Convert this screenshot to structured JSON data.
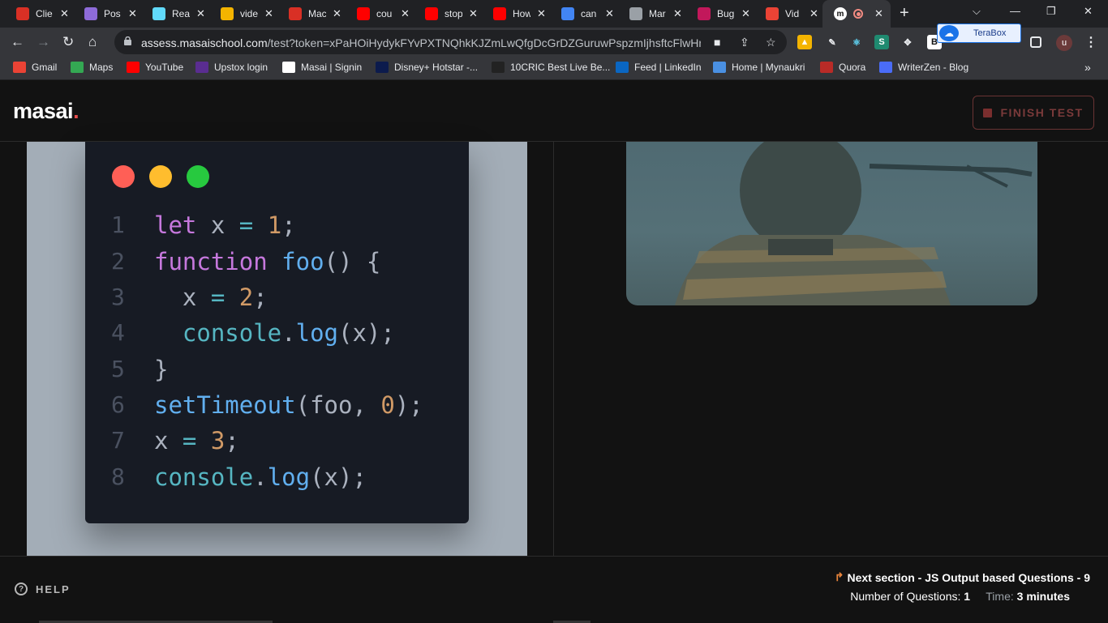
{
  "browser": {
    "tabs": [
      {
        "title": "Clie",
        "icon": "pin-icon",
        "color": "#d93025"
      },
      {
        "title": "Pos",
        "icon": "postman-icon",
        "color": "#8e6bd9"
      },
      {
        "title": "Rea",
        "icon": "react-icon",
        "color": "#61dafb"
      },
      {
        "title": "vide",
        "icon": "drive-icon",
        "color": "#f4b400"
      },
      {
        "title": "Mac",
        "icon": "baseball-icon",
        "color": "#d93025"
      },
      {
        "title": "cou",
        "icon": "youtube-icon",
        "color": "#ff0000"
      },
      {
        "title": "stop",
        "icon": "youtube-icon",
        "color": "#ff0000"
      },
      {
        "title": "How",
        "icon": "youtube-icon",
        "color": "#ff0000"
      },
      {
        "title": "can",
        "icon": "google-icon",
        "color": "#4285f4"
      },
      {
        "title": "Mar",
        "icon": "globe-icon",
        "color": "#9aa0a6"
      },
      {
        "title": "Bug",
        "icon": "bug-icon",
        "color": "#c2185b"
      },
      {
        "title": "Vid",
        "icon": "gmail-icon",
        "color": "#ea4335"
      }
    ],
    "active_tab": {
      "icon": "masai-icon",
      "recording": true
    },
    "url_host": "assess.masaischool.com",
    "url_path": "/test?token=xPaHOiHydykFYvPXTNQhkKJZmLwQfgDcGrDZGuruwPspzmIjhsftcFlwHnUf...",
    "terabox_label": "TeraBox",
    "avatar_letter": "u",
    "bookmarks": [
      {
        "label": "Gmail",
        "icon": "gmail-icon",
        "color": "#ea4335"
      },
      {
        "label": "Maps",
        "icon": "maps-icon",
        "color": "#34a853"
      },
      {
        "label": "YouTube",
        "icon": "youtube-icon",
        "color": "#ff0000"
      },
      {
        "label": "Upstox login",
        "icon": "upstox-icon",
        "color": "#5a2d91"
      },
      {
        "label": "Masai | Signin",
        "icon": "masai-icon",
        "color": "#ffffff"
      },
      {
        "label": "Disney+ Hotstar -...",
        "icon": "hotstar-icon",
        "color": "#0c1b4d"
      },
      {
        "label": "10CRIC Best Live Be...",
        "icon": "10cric-icon",
        "color": "#222222"
      },
      {
        "label": "Feed | LinkedIn",
        "icon": "linkedin-icon",
        "color": "#0a66c2"
      },
      {
        "label": "Home | Mynaukri",
        "icon": "mynaukri-icon",
        "color": "#4a90e2"
      },
      {
        "label": "Quora",
        "icon": "quora-icon",
        "color": "#b92b27"
      },
      {
        "label": "WriterZen - Blog",
        "icon": "writerzen-icon",
        "color": "#4a6cf7"
      }
    ]
  },
  "header": {
    "logo_text": "masai",
    "logo_dot": ".",
    "finish_label": "FINISH TEST"
  },
  "code": {
    "lines": [
      {
        "n": "1"
      },
      {
        "n": "2"
      },
      {
        "n": "3"
      },
      {
        "n": "4"
      },
      {
        "n": "5"
      },
      {
        "n": "6"
      },
      {
        "n": "7"
      },
      {
        "n": "8"
      }
    ],
    "tokens": {
      "l1": [
        "let",
        " x ",
        "=",
        " ",
        "1",
        ";"
      ],
      "l2": [
        "function",
        " ",
        "foo",
        "() {"
      ],
      "l3": [
        "  x ",
        "=",
        " ",
        "2",
        ";"
      ],
      "l4": [
        "  console",
        ".",
        "log",
        "(x);"
      ],
      "l5": [
        "}"
      ],
      "l6": [
        "setTimeout",
        "(foo, ",
        "0",
        ");"
      ],
      "l7": [
        "x ",
        "=",
        " ",
        "3",
        ";"
      ],
      "l8": [
        "console",
        ".",
        "log",
        "(x);"
      ]
    }
  },
  "footer": {
    "help_label": "HELP",
    "next_section": "Next section - JS Output based Questions - 9",
    "questions_label": "Number of Questions:",
    "questions_value": "1",
    "time_label": "Time:",
    "time_value": "3 minutes"
  },
  "colors": {
    "traffic_red": "#ff5f56",
    "traffic_yellow": "#ffbd2e",
    "traffic_green": "#27c93f"
  }
}
